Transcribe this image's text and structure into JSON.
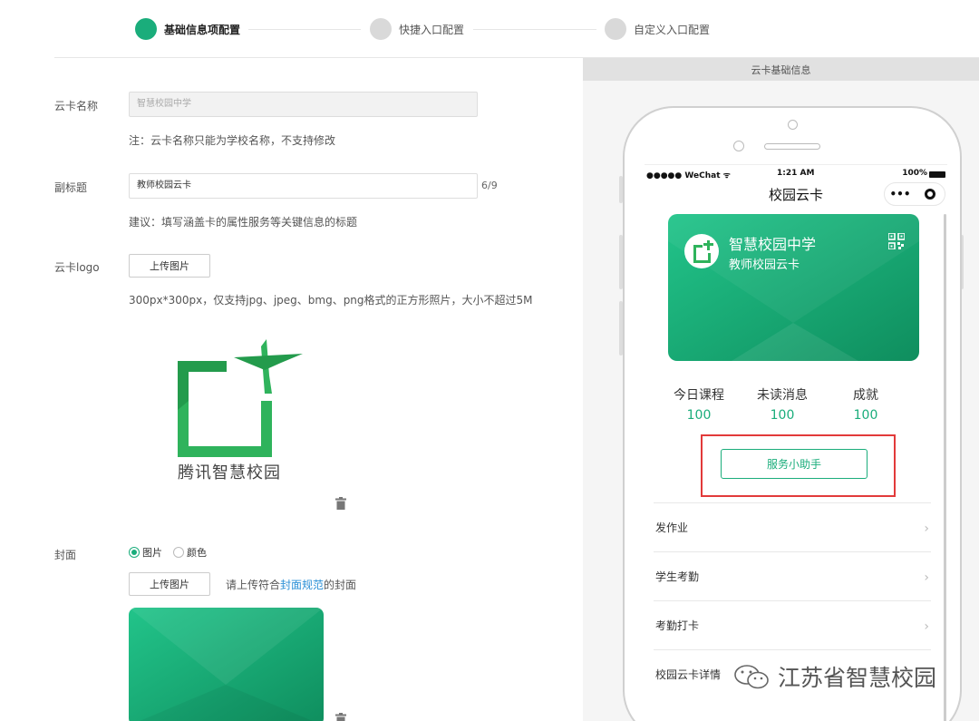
{
  "steps": [
    {
      "label": "基础信息项配置",
      "active": true
    },
    {
      "label": "快捷入口配置",
      "active": false
    },
    {
      "label": "自定义入口配置",
      "active": false
    }
  ],
  "form": {
    "card_name_label": "云卡名称",
    "card_name_value": "智慧校园中学",
    "card_name_note": "注：云卡名称只能为学校名称，不支持修改",
    "subtitle_label": "副标题",
    "subtitle_value": "教师校园云卡",
    "subtitle_counter": "6/9",
    "subtitle_note": "建议：填写涵盖卡的属性服务等关键信息的标题",
    "logo_label": "云卡logo",
    "upload_label": "上传图片",
    "logo_note": "300px*300px，仅支持jpg、jpeg、bmg、png格式的正方形照片，大小不超过5M",
    "logo_brand_text": "腾讯智慧校园",
    "cover_label": "封面",
    "cover_option_image": "图片",
    "cover_option_color": "颜色",
    "cover_upload_label": "上传图片",
    "cover_hint_prefix": "请上传符合",
    "cover_hint_link": "封面规范",
    "cover_hint_suffix": "的封面"
  },
  "preview": {
    "header": "云卡基础信息",
    "status_left": "●●●●● WeChat ᯤ",
    "status_time": "1:21 AM",
    "status_battery": "100%",
    "nav_title": "校园云卡",
    "capsule_more": "•••",
    "card": {
      "school": "智慧校园中学",
      "subtitle": "教师校园云卡"
    },
    "stats": [
      {
        "label": "今日课程",
        "value": "100"
      },
      {
        "label": "未读消息",
        "value": "100"
      },
      {
        "label": "成就",
        "value": "100"
      }
    ],
    "helper_button": "服务小助手",
    "menu": [
      {
        "label": "发作业"
      },
      {
        "label": "学生考勤"
      },
      {
        "label": "考勤打卡"
      },
      {
        "label": "校园云卡详情"
      }
    ],
    "chevron": "›"
  },
  "watermark": "江苏省智慧校园",
  "colors": {
    "accent": "#1aad7b",
    "highlight": "#e23a3a"
  }
}
